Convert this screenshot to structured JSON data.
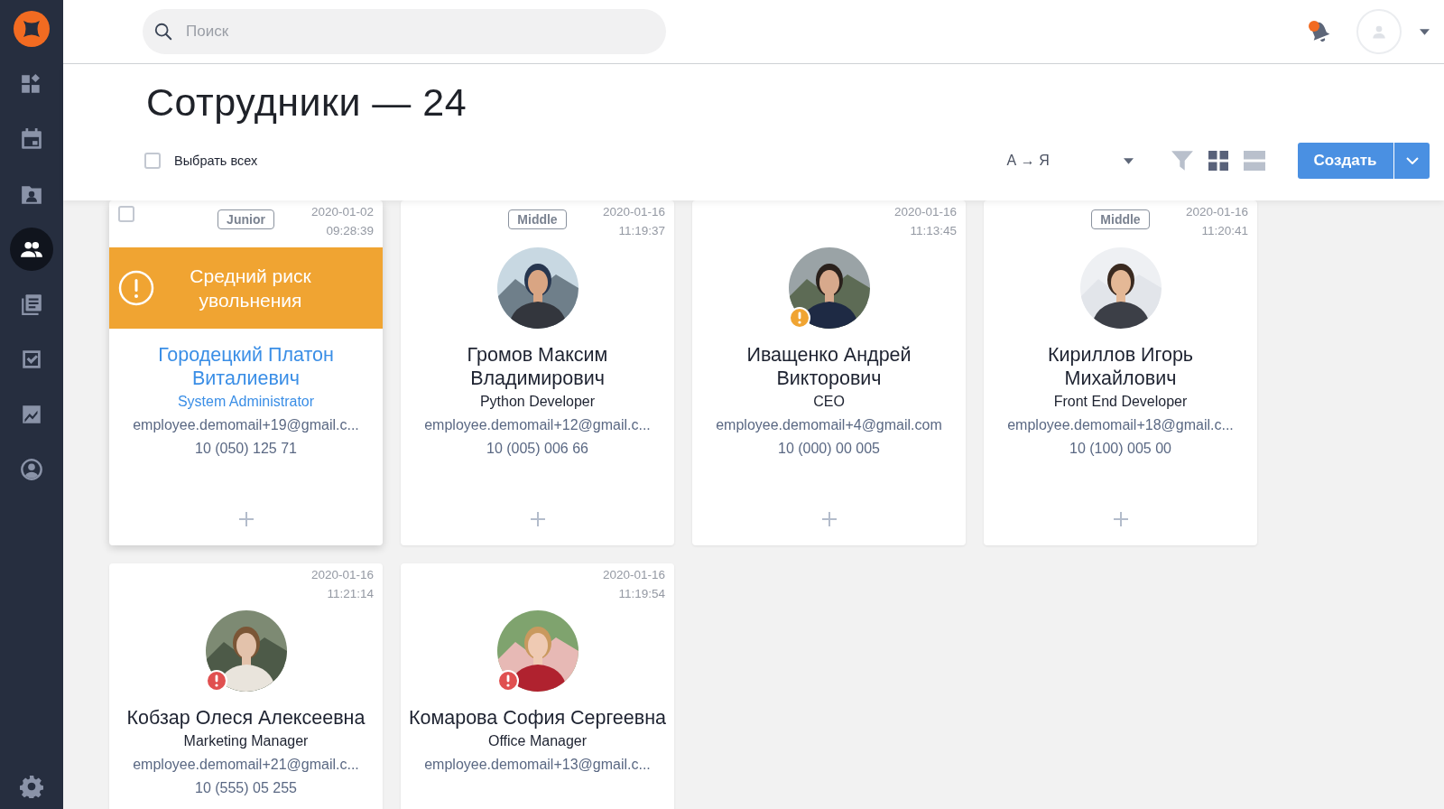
{
  "search": {
    "placeholder": "Поиск"
  },
  "notifications": {
    "unread": true
  },
  "sidebar": {
    "items": [
      {
        "kind": "dashboard",
        "selected": false
      },
      {
        "kind": "calendar",
        "selected": false
      },
      {
        "kind": "contacts",
        "selected": false
      },
      {
        "kind": "people",
        "selected": true
      },
      {
        "kind": "documents",
        "selected": false
      },
      {
        "kind": "tasks",
        "selected": false
      },
      {
        "kind": "reports",
        "selected": false
      },
      {
        "kind": "profile",
        "selected": false
      }
    ]
  },
  "page": {
    "title": "Сотрудники — 24",
    "select_all": {
      "label": "Выбрать всех",
      "checked": false
    },
    "sort": "А → Я",
    "views": [
      {
        "kind": "grid",
        "selected": true
      },
      {
        "kind": "list",
        "selected": false
      }
    ],
    "create_button": "Создать"
  },
  "cards": [
    {
      "tag": "Junior",
      "date": "2020-01-02",
      "time": "09:28:39",
      "hovered": true,
      "checked": false,
      "color": "#f0a432",
      "risk_banner": "Средний риск увольнения",
      "name": "Городецкий Платон Виталиевич",
      "role": "System Administrator",
      "email": "employee.demomail+19@gmail.c...",
      "phone": "10 (050) 125 71"
    },
    {
      "tag": "Middle",
      "date": "2020-01-16",
      "time": "11:19:37",
      "hovered": false,
      "checked": false,
      "name": "Громов Максим Владимирович",
      "role": "Python Developer",
      "email": "employee.demomail+12@gmail.c...",
      "phone": "10 (005) 006 66"
    },
    {
      "date": "2020-01-16",
      "time": "11:13:45",
      "hovered": false,
      "checked": false,
      "color": "#f0a432",
      "name": "Иващенко Андрей Викторович",
      "role": "CEO",
      "email": "employee.demomail+4@gmail.com",
      "phone": "10 (000) 00 005"
    },
    {
      "tag": "Middle",
      "date": "2020-01-16",
      "time": "11:20:41",
      "hovered": false,
      "checked": false,
      "name": "Кириллов Игорь Михайлович",
      "role": "Front End Developer",
      "email": "employee.demomail+18@gmail.c...",
      "phone": "10 (100) 005 00"
    },
    {
      "date": "2020-01-16",
      "time": "11:21:14",
      "hovered": false,
      "checked": false,
      "color": "#e05050",
      "name": "Кобзар Олеся Алексеевна",
      "role": "Marketing Manager",
      "email": "employee.demomail+21@gmail.c...",
      "phone": "10 (555) 05 255"
    },
    {
      "date": "2020-01-16",
      "time": "11:19:54",
      "hovered": false,
      "checked": false,
      "color": "#e05050",
      "name": "Комарова София Сергеевна",
      "role": "Office Manager",
      "email": "employee.demomail+13@gmail.c..."
    }
  ]
}
